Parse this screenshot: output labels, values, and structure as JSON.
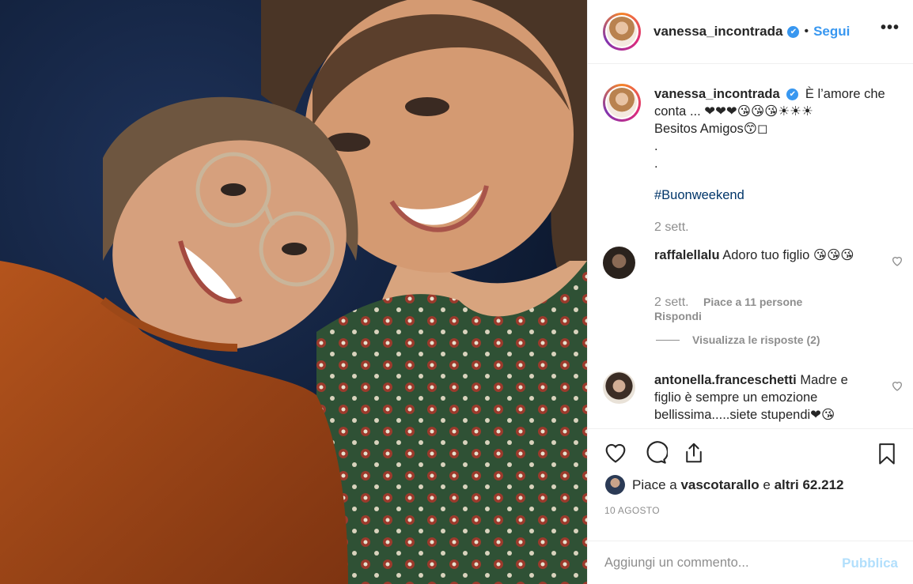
{
  "post": {
    "author": "vanessa_incontrada",
    "follow_label": "Segui",
    "separator": "•",
    "more_label": "•••",
    "verified_mark": "✔"
  },
  "caption": {
    "username": "vanessa_incontrada",
    "line1": "È l’amore che conta ... ❤❤❤😘😘😘☀☀☀",
    "line2": "Besitos Amigos😙◻",
    "line3": ".",
    "line4": ".",
    "hashtag": "#Buonweekend",
    "time": "2 sett."
  },
  "comments": [
    {
      "username": "raffalellalu",
      "text": "Adoro tuo figlio 😘😘😘",
      "time": "2 sett.",
      "likes": "Piace a 11 persone",
      "reply": "Rispondi",
      "view_replies": "Visualizza le risposte (2)"
    },
    {
      "username": "antonella.franceschetti",
      "text": "Madre e figlio è sempre un emozione bellissima.....siete stupendi❤😘"
    }
  ],
  "actions": {
    "like_icon": "heart-icon",
    "comment_icon": "comment-bubble-icon",
    "share_icon": "share-icon",
    "save_icon": "bookmark-icon"
  },
  "likes": {
    "prefix": "Piace a ",
    "user": "vascotarallo",
    "middle": " e ",
    "others": "altri 62.212"
  },
  "date": "10 AGOSTO",
  "composer": {
    "placeholder": "Aggiungi un commento...",
    "publish_label": "Pubblica"
  },
  "colors": {
    "link_blue": "#3897f0",
    "publish_disabled": "#b2dffc",
    "muted": "#8e8e8e",
    "text": "#262626"
  }
}
